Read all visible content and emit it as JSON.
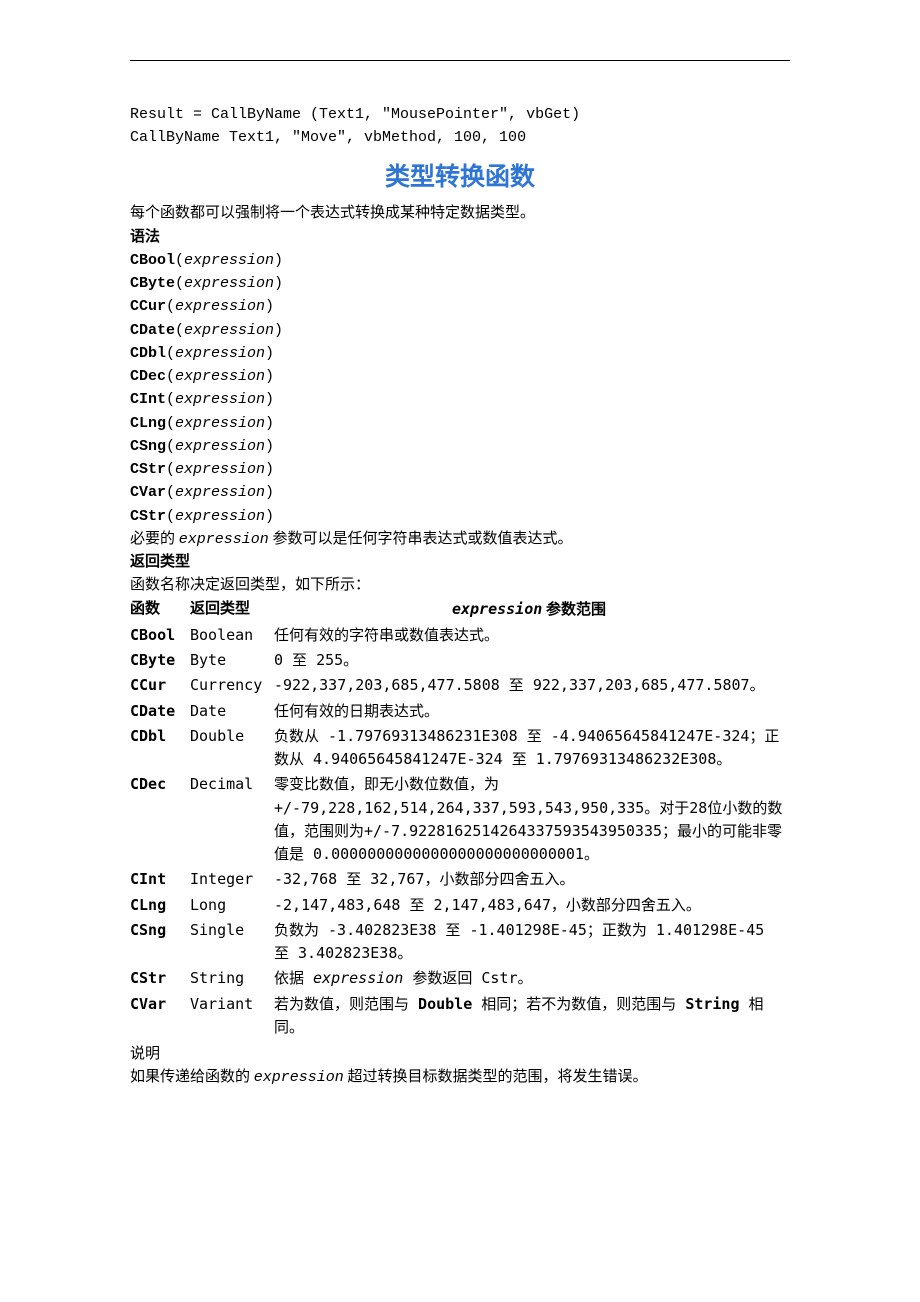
{
  "code": {
    "line1": "Result = CallByName (Text1, \"MousePointer\", vbGet)",
    "line2": "CallByName Text1, \"Move\", vbMethod, 100, 100"
  },
  "title": "类型转换函数",
  "intro": "每个函数都可以强制将一个表达式转换成某种特定数据类型。",
  "syntax_label": "语法",
  "syntax": [
    {
      "fn": "CBool",
      "arg": "expression"
    },
    {
      "fn": "CByte",
      "arg": "expression"
    },
    {
      "fn": "CCur",
      "arg": "expression"
    },
    {
      "fn": "CDate",
      "arg": "expression"
    },
    {
      "fn": "CDbl",
      "arg": "expression"
    },
    {
      "fn": "CDec",
      "arg": "expression"
    },
    {
      "fn": "CInt",
      "arg": "expression"
    },
    {
      "fn": "CLng",
      "arg": "expression"
    },
    {
      "fn": "CSng",
      "arg": "expression"
    },
    {
      "fn": "CStr",
      "arg": "expression"
    },
    {
      "fn": "CVar",
      "arg": "expression"
    },
    {
      "fn": "CStr",
      "arg": "expression"
    }
  ],
  "param_note": {
    "prefix": "必要的 ",
    "expr": "expression",
    "suffix": " 参数可以是任何字符串表达式或数值表达式。"
  },
  "return_type_label": "返回类型",
  "return_type_note": "函数名称决定返回类型，如下所示：",
  "table": {
    "headers": {
      "fn": "函数",
      "ret": "返回类型",
      "expr": "expression",
      "range_suffix": " 参数范围"
    },
    "rows": [
      {
        "fn": "CBool",
        "ret": "Boolean",
        "range": "任何有效的字符串或数值表达式。"
      },
      {
        "fn": "CByte",
        "ret": "Byte",
        "range": "0 至 255。"
      },
      {
        "fn": "CCur",
        "ret": "Currency",
        "range": "-922,337,203,685,477.5808 至 922,337,203,685,477.5807。"
      },
      {
        "fn": "CDate",
        "ret": "Date",
        "range": "任何有效的日期表达式。"
      },
      {
        "fn": "CDbl",
        "ret": "Double",
        "range": "负数从 -1.79769313486231E308 至 -4.94065645841247E-324；正数从 4.94065645841247E-324 至 1.79769313486232E308。"
      },
      {
        "fn": "CDec",
        "ret": "Decimal",
        "range": "零变比数值，即无小数位数值，为 +/-79,228,162,514,264,337,593,543,950,335。对于28位小数的数值，范围则为+/-7.9228162514264337593543950335；最小的可能非零值是 0.0000000000000000000000000001。"
      },
      {
        "fn": "CInt",
        "ret": "Integer",
        "range": "-32,768 至 32,767，小数部分四舍五入。"
      },
      {
        "fn": "CLng",
        "ret": "Long",
        "range": "-2,147,483,648 至 2,147,483,647，小数部分四舍五入。"
      },
      {
        "fn": "CSng",
        "ret": "Single",
        "range": "负数为 -3.402823E38 至 -1.401298E-45；正数为 1.401298E-45 至 3.402823E38。"
      }
    ],
    "cstr": {
      "fn": "CStr",
      "ret": "String",
      "prefix": "依据 ",
      "expr": "expression",
      "suffix": " 参数返回 Cstr。"
    },
    "cvar": {
      "fn": "CVar",
      "ret": "Variant",
      "p1": "若为数值，则范围与 ",
      "b1": "Double",
      "p2": " 相同；若不为数值，则范围与 ",
      "b2": "String",
      "p3": " 相同。"
    }
  },
  "explain_label": "说明",
  "explain_note": {
    "prefix": "如果传递给函数的 ",
    "expr": "expression",
    "suffix": " 超过转换目标数据类型的范围，将发生错误。"
  }
}
